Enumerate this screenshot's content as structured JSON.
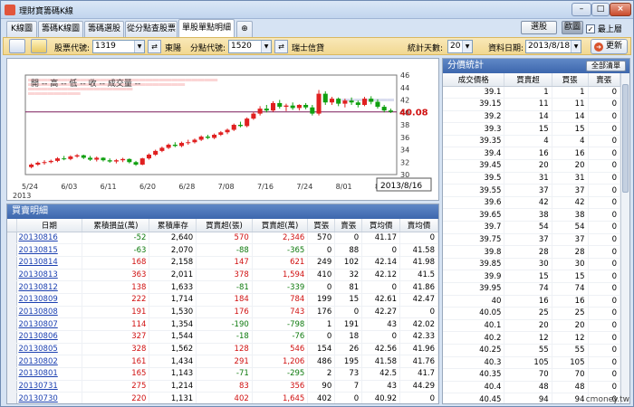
{
  "window": {
    "title": "理財寶籌碼K線"
  },
  "tabs": [
    {
      "label": "K線圖"
    },
    {
      "label": "籌碼K線圖"
    },
    {
      "label": "籌碼選股"
    },
    {
      "label": "從分點查股票"
    },
    {
      "label": "單股單點明細"
    }
  ],
  "top_buttons": {
    "select": "選股",
    "dark": "歐圖",
    "topmost": "最上層"
  },
  "toolbar": {
    "stock_label": "股票代號:",
    "stock_value": "1319",
    "stock_name": "東陽",
    "branch_label": "分點代號:",
    "branch_value": "1520",
    "branch_name": "瑞士信貸",
    "days_label": "統計天數:",
    "days_value": "20",
    "date_label": "資料日期:",
    "date_value": "2013/8/18",
    "refresh": "更新"
  },
  "chart_data": {
    "type": "candlestick",
    "legend": "開 -- 高 -- 低 -- 收 -- 成交量 --",
    "current_price": "40.08",
    "current_value": 40.08,
    "ylim": [
      30,
      46
    ],
    "y_ticks": [
      "46",
      "44",
      "42",
      "40",
      "38",
      "36",
      "34",
      "32",
      "30"
    ],
    "x_ticks": [
      "5/24",
      "6/03",
      "6/11",
      "6/20",
      "6/28",
      "7/08",
      "7/16",
      "7/24",
      "8/01",
      "8/09"
    ],
    "x_year": "2013",
    "date_box": "2013/8/16",
    "candles": [
      [
        31.2,
        31.8,
        31,
        31.6
      ],
      [
        31.6,
        32.1,
        31.4,
        31.9
      ],
      [
        31.9,
        32.3,
        31.6,
        32
      ],
      [
        32,
        32.4,
        31.8,
        32.2
      ],
      [
        32.2,
        32.8,
        32,
        32.6
      ],
      [
        32.6,
        33,
        32.3,
        32.5
      ],
      [
        32.5,
        33.1,
        32.3,
        32.9
      ],
      [
        32.9,
        33.3,
        32.7,
        33.1
      ],
      [
        33.1,
        33.2,
        32.5,
        32.7
      ],
      [
        32.7,
        33,
        32.2,
        32.4
      ],
      [
        32.4,
        32.9,
        32.1,
        32.7
      ],
      [
        32.7,
        32.8,
        32.1,
        32.3
      ],
      [
        32.3,
        32.6,
        31.9,
        32.1
      ],
      [
        32.1,
        32.5,
        31.8,
        32.3
      ],
      [
        32.3,
        32.7,
        32,
        32.5
      ],
      [
        32.5,
        32.6,
        31.8,
        32
      ],
      [
        32,
        32.2,
        31.4,
        31.6
      ],
      [
        31.6,
        32.7,
        31.5,
        32.6
      ],
      [
        32.6,
        33.4,
        32.4,
        33.2
      ],
      [
        33.2,
        34,
        33,
        33.8
      ],
      [
        33.8,
        34.5,
        33.6,
        34.3
      ],
      [
        34.3,
        35,
        34.1,
        34.8
      ],
      [
        34.8,
        35.2,
        34.4,
        34.6
      ],
      [
        34.6,
        35.3,
        34.4,
        35.1
      ],
      [
        35.1,
        35.6,
        34.8,
        35.2
      ],
      [
        35.2,
        35.8,
        35,
        35.6
      ],
      [
        35.6,
        36.3,
        35.4,
        36.1
      ],
      [
        36.1,
        36.4,
        35.7,
        35.9
      ],
      [
        35.9,
        36.6,
        35.7,
        36.4
      ],
      [
        36.4,
        37,
        36.2,
        36.8
      ],
      [
        36.8,
        37.4,
        36.5,
        37.2
      ],
      [
        37.2,
        38.2,
        37,
        38
      ],
      [
        38,
        38.5,
        37.6,
        37.8
      ],
      [
        37.8,
        39.2,
        37.6,
        39
      ],
      [
        39,
        40.1,
        38.8,
        39.8
      ],
      [
        39.8,
        41,
        39.5,
        40.6
      ],
      [
        40.6,
        41.2,
        40,
        40.3
      ],
      [
        40.3,
        41.8,
        40.1,
        41.5
      ],
      [
        41.5,
        42,
        40.6,
        40.9
      ],
      [
        40.9,
        41.4,
        40.2,
        41.1
      ],
      [
        41.1,
        41.6,
        40.4,
        40.7
      ],
      [
        40.7,
        41.3,
        40.3,
        41.2
      ],
      [
        41.2,
        41.5,
        40.5,
        40.8
      ],
      [
        40.8,
        41.2,
        39.5,
        39.8
      ],
      [
        39.8,
        43.6,
        39.5,
        43
      ],
      [
        43,
        43.4,
        41.2,
        41.6
      ],
      [
        41.6,
        42.5,
        41.2,
        42.2
      ],
      [
        42.2,
        42.4,
        41,
        41.4
      ],
      [
        41.4,
        42.2,
        40.8,
        41.9
      ],
      [
        41.9,
        42.4,
        41.2,
        41.6
      ],
      [
        41.6,
        41.9,
        40.8,
        41.2
      ],
      [
        41.2,
        42.5,
        41,
        42.2
      ],
      [
        42.2,
        42.6,
        41.3,
        41.7
      ],
      [
        41.7,
        42.1,
        40.6,
        40.9
      ],
      [
        40.9,
        41.2,
        40,
        40.3
      ],
      [
        40.3,
        40.6,
        39.9,
        40.08
      ]
    ],
    "buy_bars_to": 28,
    "sell_bars_from": 48
  },
  "trades": {
    "title": "買賣明細",
    "headers": [
      "日期",
      "累積損益(萬)",
      "累積庫存",
      "買賣超(張)",
      "買賣超(萬)",
      "買張",
      "賣張",
      "買均價",
      "賣均價"
    ],
    "rows": [
      [
        "20130816",
        "-52",
        "2,640",
        "570",
        "2,346",
        "570",
        "0",
        "41.17",
        "0"
      ],
      [
        "20130815",
        "-63",
        "2,070",
        "-88",
        "-365",
        "0",
        "88",
        "0",
        "41.58"
      ],
      [
        "20130814",
        "168",
        "2,158",
        "147",
        "621",
        "249",
        "102",
        "42.14",
        "41.98"
      ],
      [
        "20130813",
        "363",
        "2,011",
        "378",
        "1,594",
        "410",
        "32",
        "42.12",
        "41.5"
      ],
      [
        "20130812",
        "138",
        "1,633",
        "-81",
        "-339",
        "0",
        "81",
        "0",
        "41.86"
      ],
      [
        "20130809",
        "222",
        "1,714",
        "184",
        "784",
        "199",
        "15",
        "42.61",
        "42.47"
      ],
      [
        "20130808",
        "191",
        "1,530",
        "176",
        "743",
        "176",
        "0",
        "42.27",
        "0"
      ],
      [
        "20130807",
        "114",
        "1,354",
        "-190",
        "-798",
        "1",
        "191",
        "43",
        "42.02"
      ],
      [
        "20130806",
        "327",
        "1,544",
        "-18",
        "-76",
        "0",
        "18",
        "0",
        "42.33"
      ],
      [
        "20130805",
        "328",
        "1,562",
        "128",
        "546",
        "154",
        "26",
        "42.56",
        "41.96"
      ],
      [
        "20130802",
        "161",
        "1,434",
        "291",
        "1,206",
        "486",
        "195",
        "41.58",
        "41.76"
      ],
      [
        "20130801",
        "165",
        "1,143",
        "-71",
        "-295",
        "2",
        "73",
        "42.5",
        "41.7"
      ],
      [
        "20130731",
        "275",
        "1,214",
        "83",
        "356",
        "90",
        "7",
        "43",
        "44.29"
      ],
      [
        "20130730",
        "220",
        "1,131",
        "402",
        "1,645",
        "402",
        "0",
        "40.92",
        "0"
      ]
    ]
  },
  "distribution": {
    "title": "分價統計",
    "all_button": "全部清單",
    "headers": [
      "成交價格",
      "買賣超",
      "買張",
      "賣張"
    ],
    "rows": [
      [
        "39.1",
        "1",
        "1",
        "0"
      ],
      [
        "39.15",
        "11",
        "11",
        "0"
      ],
      [
        "39.2",
        "14",
        "14",
        "0"
      ],
      [
        "39.3",
        "15",
        "15",
        "0"
      ],
      [
        "39.35",
        "4",
        "4",
        "0"
      ],
      [
        "39.4",
        "16",
        "16",
        "0"
      ],
      [
        "39.45",
        "20",
        "20",
        "0"
      ],
      [
        "39.5",
        "31",
        "31",
        "0"
      ],
      [
        "39.55",
        "37",
        "37",
        "0"
      ],
      [
        "39.6",
        "42",
        "42",
        "0"
      ],
      [
        "39.65",
        "38",
        "38",
        "0"
      ],
      [
        "39.7",
        "54",
        "54",
        "0"
      ],
      [
        "39.75",
        "37",
        "37",
        "0"
      ],
      [
        "39.8",
        "28",
        "28",
        "0"
      ],
      [
        "39.85",
        "30",
        "30",
        "0"
      ],
      [
        "39.9",
        "15",
        "15",
        "0"
      ],
      [
        "39.95",
        "74",
        "74",
        "0"
      ],
      [
        "40",
        "16",
        "16",
        "0"
      ],
      [
        "40.05",
        "25",
        "25",
        "0"
      ],
      [
        "40.1",
        "20",
        "20",
        "0"
      ],
      [
        "40.2",
        "12",
        "12",
        "0"
      ],
      [
        "40.25",
        "55",
        "55",
        "0"
      ],
      [
        "40.3",
        "105",
        "105",
        "0"
      ],
      [
        "40.35",
        "70",
        "70",
        "0"
      ],
      [
        "40.4",
        "48",
        "48",
        "0"
      ],
      [
        "40.45",
        "94",
        "94",
        "0"
      ]
    ]
  },
  "watermark": "cmoney.tw",
  "colors": {
    "up": "#e02020",
    "down": "#10a010",
    "accent": "#3d67ad"
  }
}
